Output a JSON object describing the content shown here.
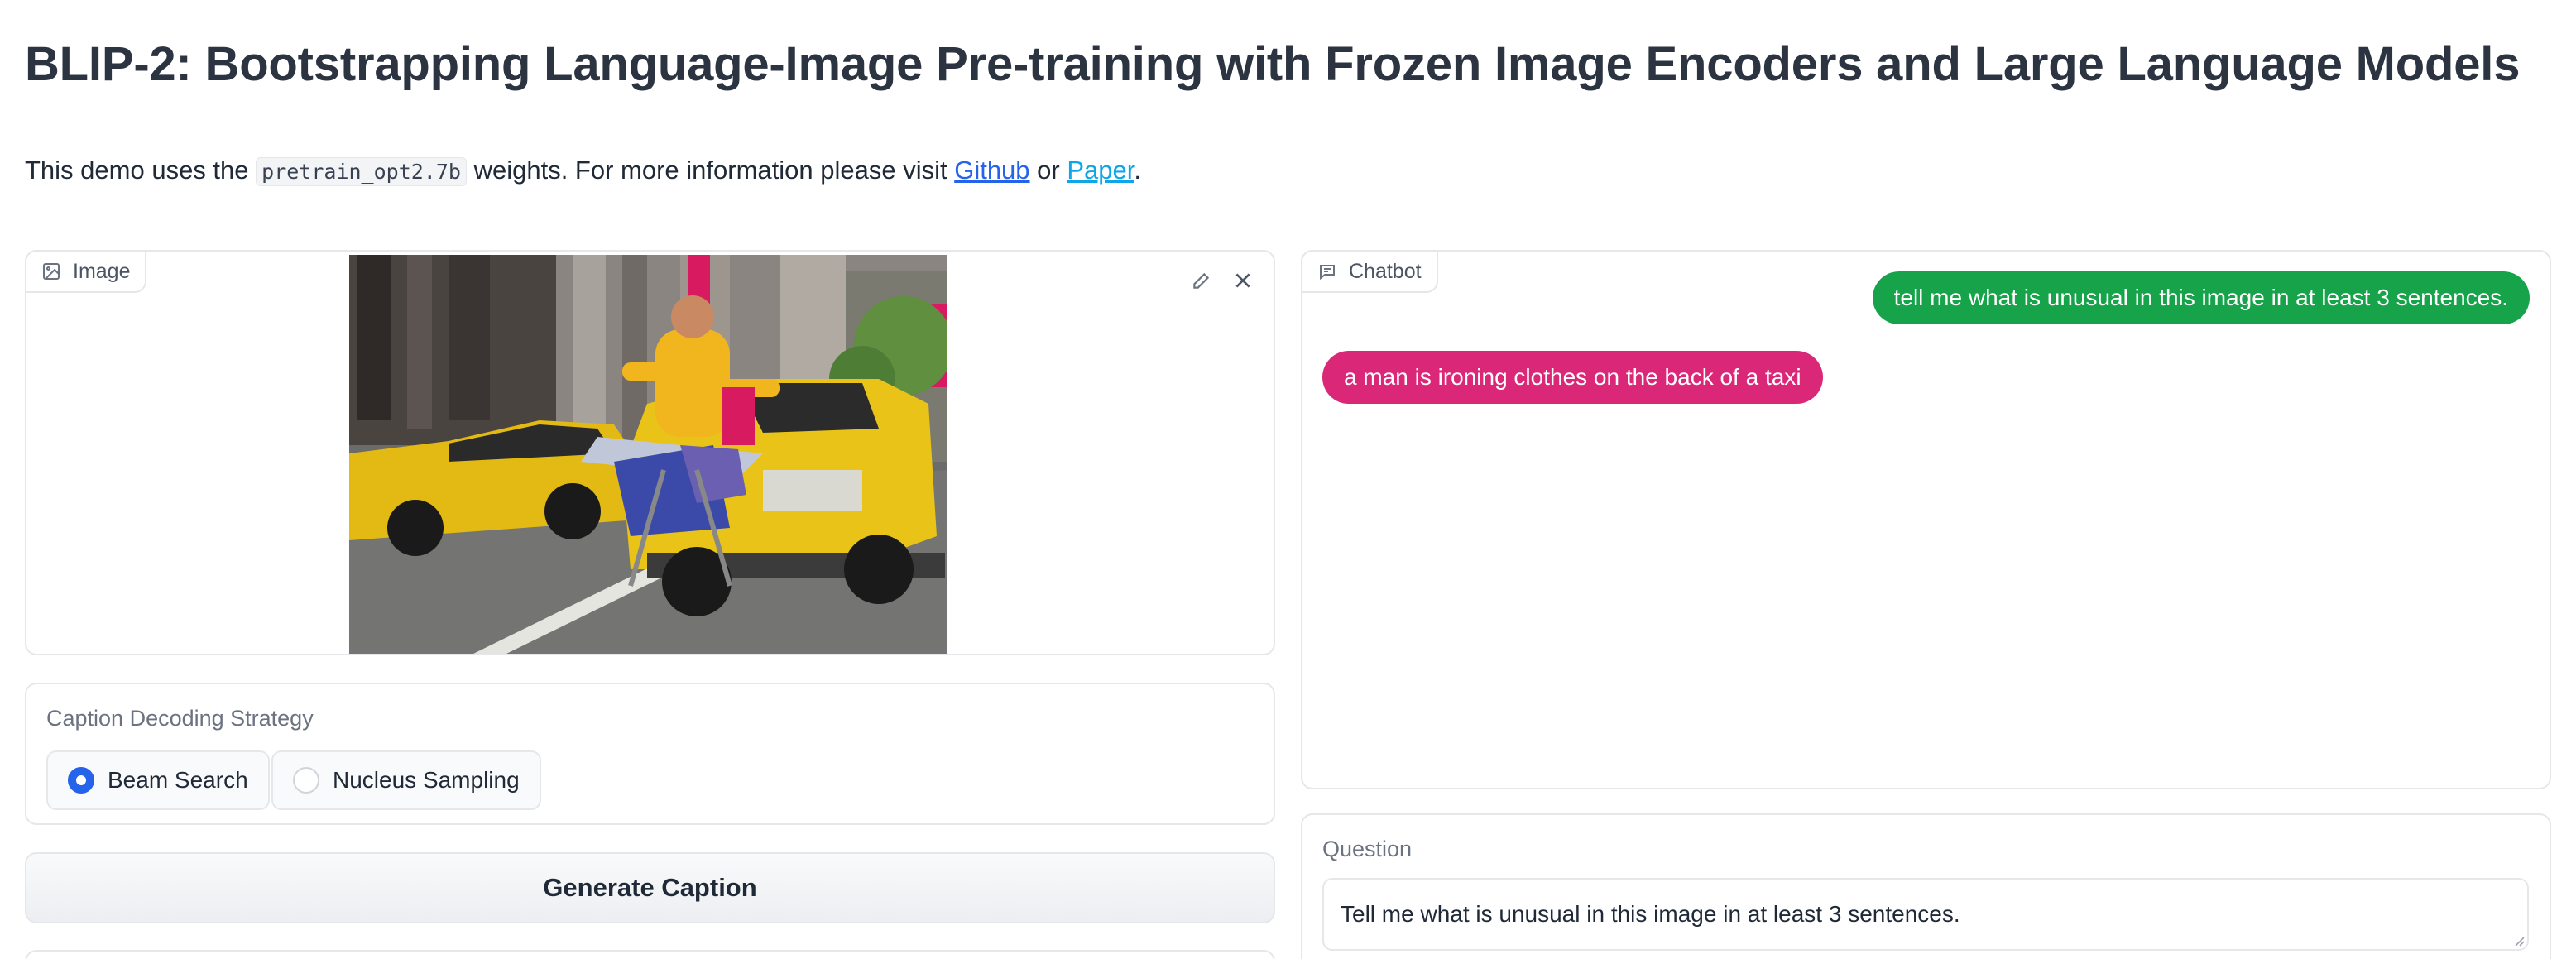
{
  "header": {
    "title": "BLIP-2: Bootstrapping Language-Image Pre-training with Frozen Image Encoders and Large Language Models",
    "intro_before": "This demo uses the ",
    "intro_code": "pretrain_opt2.7b",
    "intro_middle": " weights. For more information please visit ",
    "github_link": "Github",
    "intro_or": " or ",
    "paper_link": "Paper",
    "intro_end": "."
  },
  "image_panel": {
    "label": "Image",
    "icon": "image-icon",
    "tools": [
      "edit-icon",
      "close-icon"
    ]
  },
  "caption_strategy": {
    "label": "Caption Decoding Strategy",
    "options": [
      {
        "label": "Beam Search",
        "selected": true
      },
      {
        "label": "Nucleus Sampling",
        "selected": false
      }
    ]
  },
  "generate_button": {
    "label": "Generate Caption"
  },
  "chatbot": {
    "label": "Chatbot",
    "icon": "chat-icon",
    "messages": [
      {
        "role": "user",
        "text": "tell me what is unusual in this image in at least 3 sentences.",
        "color": "#16a34a"
      },
      {
        "role": "bot",
        "text": "a man is ironing clothes on the back of a taxi",
        "color": "#db2777"
      }
    ]
  },
  "question": {
    "label": "Question",
    "value": "Tell me what is unusual in this image in at least 3 sentences."
  },
  "colors": {
    "accent": "#2563eb",
    "link": "#2563eb",
    "taxi_yellow": "#e9c318"
  }
}
